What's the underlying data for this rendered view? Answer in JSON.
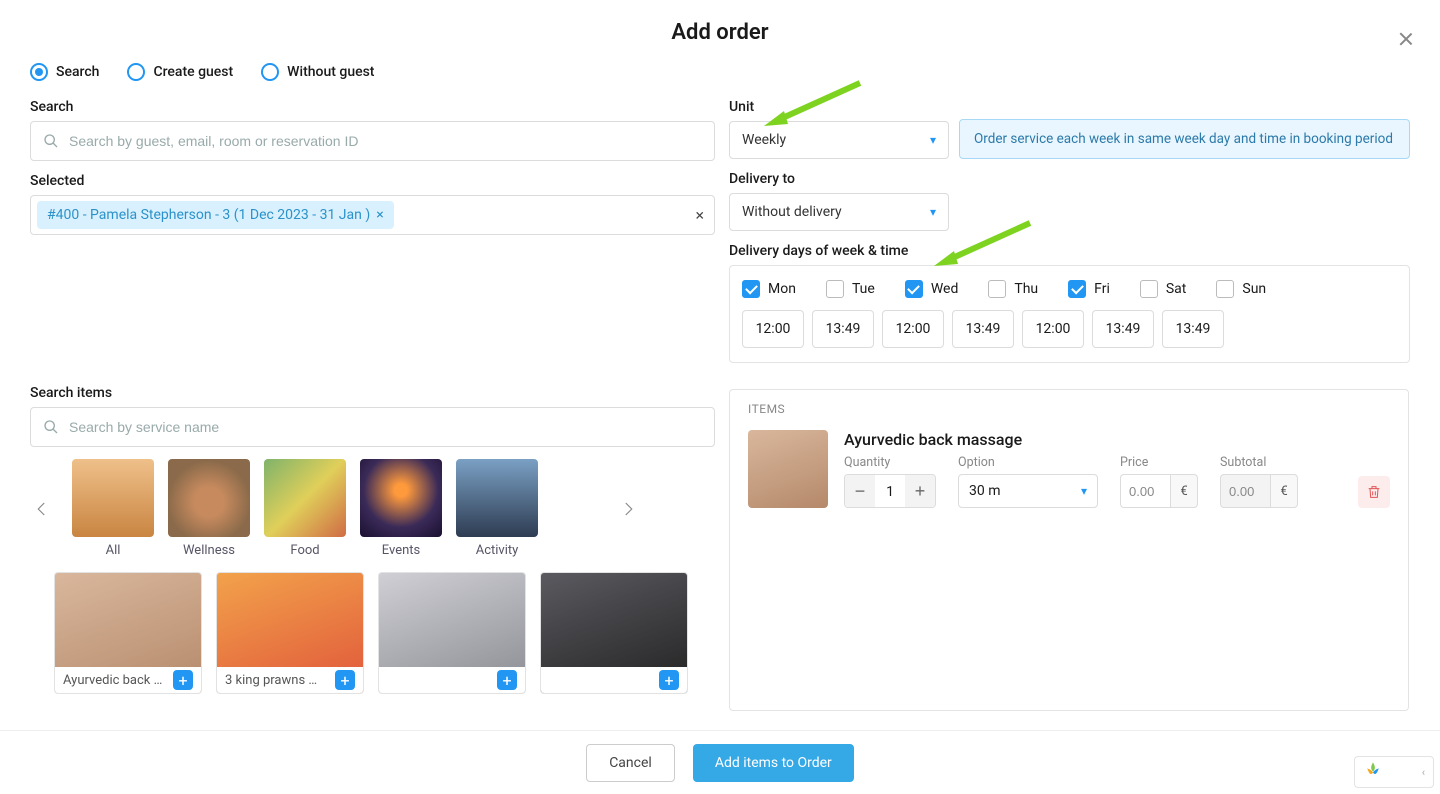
{
  "modal": {
    "title": "Add order"
  },
  "tabs": [
    {
      "label": "Search",
      "checked": true
    },
    {
      "label": "Create guest",
      "checked": false
    },
    {
      "label": "Without guest",
      "checked": false
    }
  ],
  "search": {
    "label": "Search",
    "placeholder": "Search by guest, email, room or reservation ID"
  },
  "selected": {
    "label": "Selected",
    "chip": "#400 - Pamela Stepherson - 3 (1 Dec 2023 - 31 Jan )"
  },
  "unit": {
    "label": "Unit",
    "value": "Weekly",
    "info": "Order service each week in same week day and time in booking period"
  },
  "delivery": {
    "label": "Delivery to",
    "value": "Without delivery"
  },
  "dow": {
    "label": "Delivery days of week & time",
    "days": [
      {
        "label": "Mon",
        "checked": true
      },
      {
        "label": "Tue",
        "checked": false
      },
      {
        "label": "Wed",
        "checked": true
      },
      {
        "label": "Thu",
        "checked": false
      },
      {
        "label": "Fri",
        "checked": true
      },
      {
        "label": "Sat",
        "checked": false
      },
      {
        "label": "Sun",
        "checked": false
      }
    ],
    "times": [
      "12:00",
      "13:49",
      "12:00",
      "13:49",
      "12:00",
      "13:49",
      "13:49"
    ]
  },
  "search_items": {
    "label": "Search items",
    "placeholder": "Search by service name",
    "categories": [
      "All",
      "Wellness",
      "Food",
      "Events",
      "Activity"
    ],
    "services": [
      "Ayurvedic back …",
      "3 king prawns …",
      "",
      ""
    ]
  },
  "items_panel": {
    "header": "ITEMS",
    "item": {
      "name": "Ayurvedic back massage",
      "qty_label": "Quantity",
      "qty_value": "1",
      "option_label": "Option",
      "option_value": "30 m",
      "price_label": "Price",
      "price_value": "0.00",
      "subtotal_label": "Subtotal",
      "subtotal_value": "0.00",
      "currency": "€"
    }
  },
  "footer": {
    "cancel": "Cancel",
    "submit": "Add items to Order"
  }
}
